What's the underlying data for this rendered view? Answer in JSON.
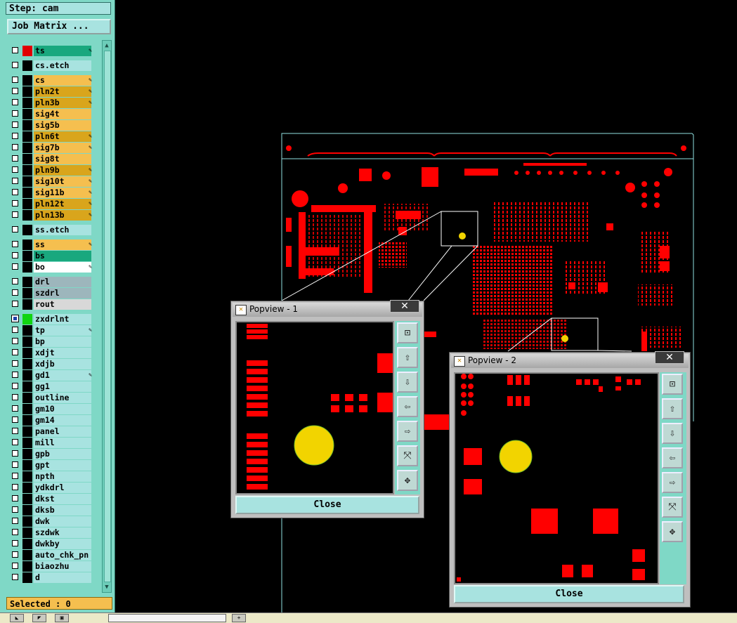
{
  "step_label": "Step: cam",
  "job_matrix_button": "Job Matrix ...",
  "layers": [
    {
      "name": "ts",
      "color": "#19a87e",
      "editable": true
    },
    {
      "name": "cs.etch",
      "color": "#a8e3e0"
    },
    {
      "name": "cs",
      "color": "#f5bf4f",
      "editable": true
    },
    {
      "name": "pln2t",
      "color": "#d9a51c",
      "editable": true
    },
    {
      "name": "pln3b",
      "color": "#d9a51c",
      "editable": true
    },
    {
      "name": "sig4t",
      "color": "#f5bf4f"
    },
    {
      "name": "sig5b",
      "color": "#f5bf4f"
    },
    {
      "name": "pln6t",
      "color": "#d9a51c",
      "editable": true
    },
    {
      "name": "sig7b",
      "color": "#f5bf4f",
      "editable": true
    },
    {
      "name": "sig8t",
      "color": "#f5bf4f"
    },
    {
      "name": "pln9b",
      "color": "#d9a51c",
      "editable": true
    },
    {
      "name": "sig10t",
      "color": "#f5bf4f",
      "editable": true
    },
    {
      "name": "sig11b",
      "color": "#f5bf4f",
      "editable": true
    },
    {
      "name": "pln12t",
      "color": "#d9a51c",
      "editable": true
    },
    {
      "name": "pln13b",
      "color": "#d9a51c",
      "editable": true
    },
    {
      "name": "ss.etch",
      "color": "#a8e3e0"
    },
    {
      "name": "ss",
      "color": "#f5bf4f",
      "editable": true
    },
    {
      "name": "bs",
      "color": "#19a87e"
    },
    {
      "name": "bo",
      "color": "#ffffff",
      "editable": true
    },
    {
      "name": "drl",
      "color": "#9db6bc"
    },
    {
      "name": "szdrl",
      "color": "#9db6bc"
    },
    {
      "name": "rout",
      "color": "#d8d8d8"
    },
    {
      "name": "zxdrlnt",
      "color": "#a8e3e0",
      "active": true
    },
    {
      "name": "tp",
      "color": "#a8e3e0",
      "editable": true
    },
    {
      "name": "bp",
      "color": "#a8e3e0"
    },
    {
      "name": "xdjt",
      "color": "#a8e3e0"
    },
    {
      "name": "xdjb",
      "color": "#a8e3e0"
    },
    {
      "name": "gd1",
      "color": "#a8e3e0",
      "editable": true
    },
    {
      "name": "gg1",
      "color": "#a8e3e0"
    },
    {
      "name": "outline",
      "color": "#a8e3e0"
    },
    {
      "name": "gm10",
      "color": "#a8e3e0"
    },
    {
      "name": "gm14",
      "color": "#a8e3e0"
    },
    {
      "name": "panel",
      "color": "#a8e3e0"
    },
    {
      "name": "mill",
      "color": "#a8e3e0"
    },
    {
      "name": "gpb",
      "color": "#a8e3e0"
    },
    {
      "name": "gpt",
      "color": "#a8e3e0"
    },
    {
      "name": "npth",
      "color": "#a8e3e0"
    },
    {
      "name": "ydkdrl",
      "color": "#a8e3e0"
    },
    {
      "name": "dkst",
      "color": "#a8e3e0"
    },
    {
      "name": "dksb",
      "color": "#a8e3e0"
    },
    {
      "name": "dwk",
      "color": "#a8e3e0"
    },
    {
      "name": "szdwk",
      "color": "#a8e3e0"
    },
    {
      "name": "dwkby",
      "color": "#a8e3e0"
    },
    {
      "name": "auto_chk_pn",
      "color": "#a8e3e0"
    },
    {
      "name": "biaozhu",
      "color": "#a8e3e0"
    },
    {
      "name": "d",
      "color": "#a8e3e0"
    }
  ],
  "selected_status": "Selected : 0",
  "popview1": {
    "title": "Popview - 1",
    "close_label": "Close"
  },
  "popview2": {
    "title": "Popview - 2",
    "close_label": "Close"
  },
  "popview_tools": [
    "zoom-fit-icon",
    "pan-up-icon",
    "pan-down-icon",
    "pan-left-icon",
    "pan-right-icon",
    "zoom-in-icon",
    "zoom-out-icon"
  ],
  "colors": {
    "board_copper": "#ff0000",
    "highlight_pad": "#f2d400",
    "panel_bg": "#7fd8c6",
    "outline": "#8fe0e0"
  }
}
